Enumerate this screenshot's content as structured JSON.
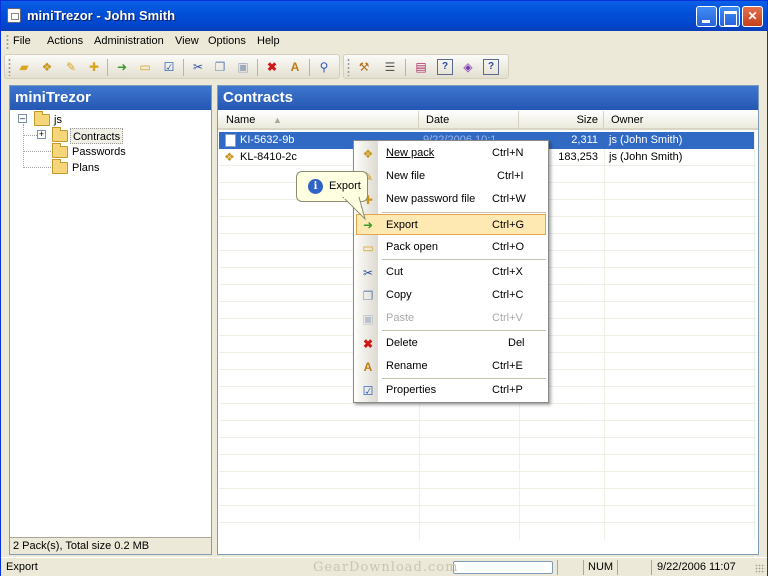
{
  "window": {
    "title": "miniTrezor - John Smith"
  },
  "menu": [
    "File",
    "Actions",
    "Administration",
    "View",
    "Options",
    "Help"
  ],
  "tree_panel": {
    "title": "miniTrezor",
    "root": "js",
    "children": [
      "Contracts",
      "Passwords",
      "Plans"
    ],
    "status": "2 Pack(s), Total size 0.2 MB"
  },
  "list_panel": {
    "title": "Contracts",
    "columns": [
      "Name",
      "Date",
      "Size",
      "Owner"
    ],
    "rows": [
      {
        "name": "KI-5632-9b",
        "date": "9/22/2006 10:1",
        "size": "2,311",
        "owner": "js (John Smith)"
      },
      {
        "name": "KL-8410-2c",
        "date": "",
        "size": "183,253",
        "owner": "js (John Smith)"
      }
    ]
  },
  "context_menu": [
    {
      "label": "New pack",
      "shortcut": "Ctrl+N"
    },
    {
      "label": "New file",
      "shortcut": "Ctrl+I"
    },
    {
      "label": "New password file",
      "shortcut": "Ctrl+W"
    },
    {
      "label": "Export",
      "shortcut": "Ctrl+G"
    },
    {
      "label": "Pack open",
      "shortcut": "Ctrl+O"
    },
    {
      "label": "Cut",
      "shortcut": "Ctrl+X"
    },
    {
      "label": "Copy",
      "shortcut": "Ctrl+C"
    },
    {
      "label": "Paste",
      "shortcut": "Ctrl+V"
    },
    {
      "label": "Delete",
      "shortcut": "Del"
    },
    {
      "label": "Rename",
      "shortcut": "Ctrl+E"
    },
    {
      "label": "Properties",
      "shortcut": "Ctrl+P"
    }
  ],
  "tooltip": {
    "text": "Export"
  },
  "statusbar": {
    "text": "Export",
    "num": "NUM",
    "datetime": "9/22/2006 11:07"
  },
  "watermark": "GearDownload.com",
  "colors": {
    "title_blue": "#0250d8",
    "panel_head": "#2f64c0",
    "selection": "#316ac5",
    "highlight": "#ffe9b3"
  }
}
